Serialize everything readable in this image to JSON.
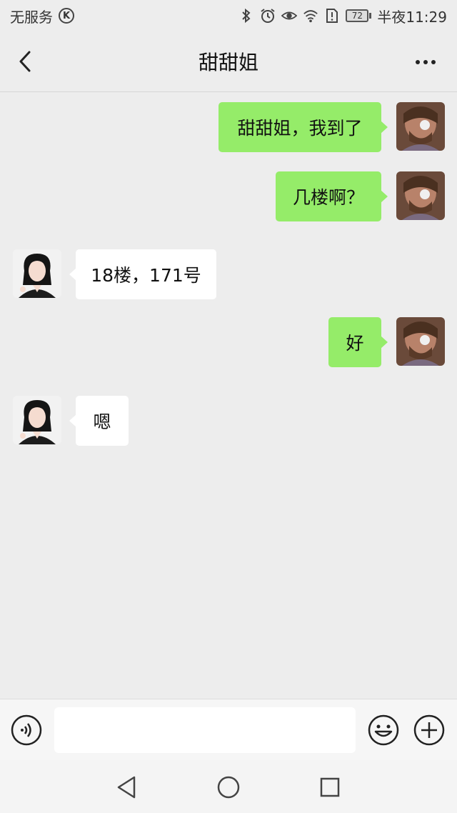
{
  "status_bar": {
    "carrier": "无服务",
    "carrier_badge": "K",
    "battery_level": "72",
    "time": "半夜11:29"
  },
  "header": {
    "title": "甜甜姐"
  },
  "messages": [
    {
      "from": "me",
      "text": "甜甜姐，我到了"
    },
    {
      "from": "me",
      "text": "几楼啊？"
    },
    {
      "from": "contact",
      "text": "18楼，171号"
    },
    {
      "from": "me",
      "text": "好"
    },
    {
      "from": "contact",
      "text": "嗯"
    }
  ],
  "input": {
    "placeholder": "",
    "value": ""
  },
  "colors": {
    "background": "#ededed",
    "my_bubble": "#95ec69",
    "contact_bubble": "#ffffff"
  },
  "icons": [
    "back-arrow-icon",
    "more-dots-icon",
    "voice-icon",
    "emoji-icon",
    "plus-icon",
    "nav-back-icon",
    "nav-home-icon",
    "nav-recents-icon"
  ]
}
